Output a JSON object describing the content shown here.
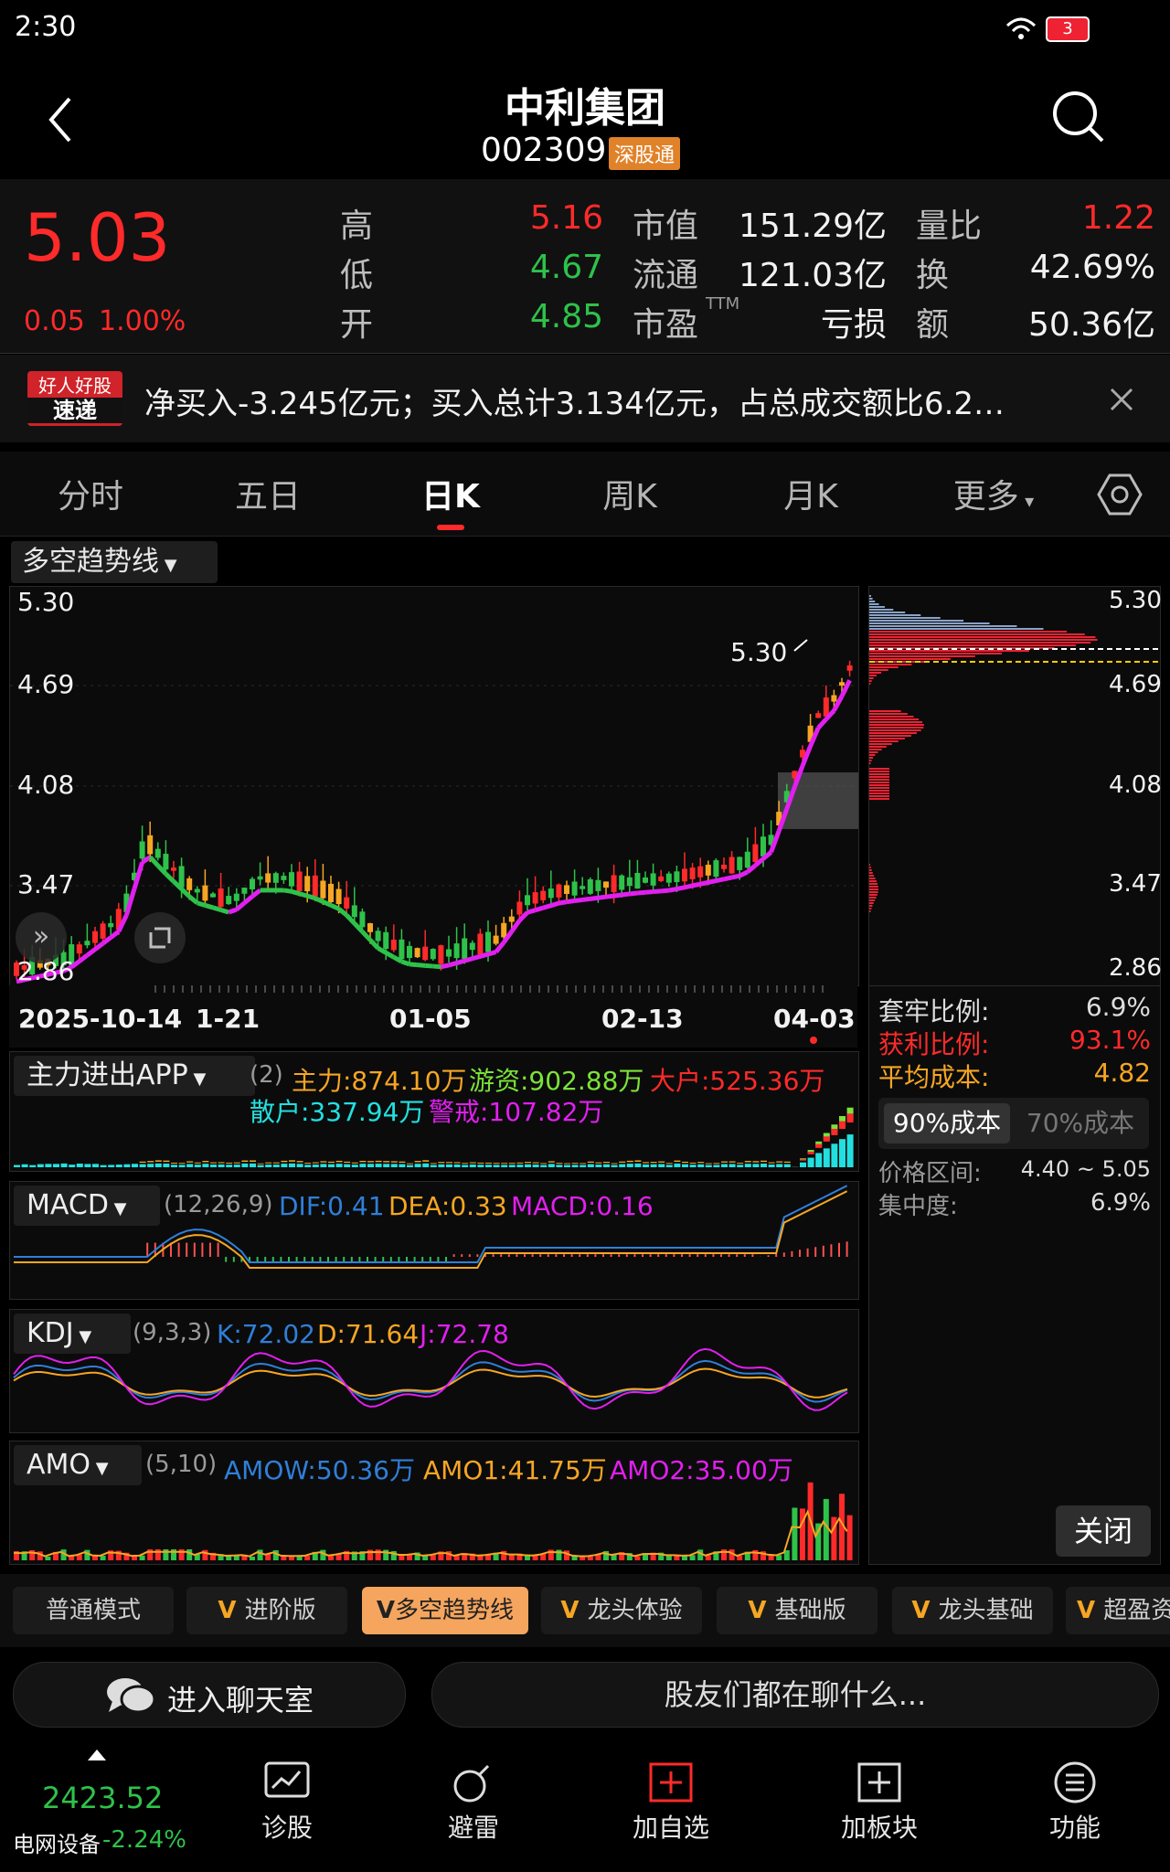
{
  "status": {
    "time": "2:30",
    "battery": "3"
  },
  "header": {
    "title": "中利集团",
    "code": "002309",
    "tag": "深股通"
  },
  "quote": {
    "price": "5.03",
    "change": "0.05",
    "change_pct": "1.00%",
    "high_label": "高",
    "high": "5.16",
    "low_label": "低",
    "low": "4.67",
    "open_label": "开",
    "open": "4.85",
    "mcap_label": "市值",
    "mcap": "151.29亿",
    "float_label": "流通",
    "float": "121.03亿",
    "pe_label": "市盈",
    "pe_sup": "TTM",
    "pe": "亏损",
    "vr_label": "量比",
    "vr": "1.22",
    "turn_label": "换",
    "turn": "42.69%",
    "amt_label": "额",
    "amt": "50.36亿"
  },
  "news": {
    "badge_top": "好人好股",
    "badge_bottom": "速递",
    "text": "净买入-3.245亿元；买入总计3.134亿元，占总成交额比6.2…"
  },
  "tabs": [
    "分时",
    "五日",
    "日K",
    "周K",
    "月K",
    "更多"
  ],
  "active_tab": "日K",
  "indicator_select": "多空趋势线",
  "price_axis": [
    "5.30",
    "4.69",
    "4.08",
    "3.47",
    "2.86"
  ],
  "date_axis": [
    "2025-10-14",
    "1-21",
    "01-05",
    "02-13",
    "04-03"
  ],
  "chart_annotation": "5.30",
  "cost": {
    "trap_label": "套牢比例:",
    "trap": "6.9%",
    "profit_label": "获利比例:",
    "profit": "93.1%",
    "avg_label": "平均成本:",
    "avg": "4.82",
    "btn90": "90%成本",
    "btn70": "70%成本",
    "range_label": "价格区间:",
    "range": "4.40 ~ 5.05",
    "conc_label": "集中度:",
    "conc": "6.9%",
    "close": "关闭"
  },
  "ind1": {
    "name": "主力进出APP",
    "param": "(2)",
    "a": "主力:874.10万",
    "b": "游资:902.88万",
    "c": "大户:525.36万",
    "d": "散户:337.94万",
    "e": "警戒:107.82万"
  },
  "macd": {
    "name": "MACD",
    "param": "(12,26,9)",
    "dif": "DIF:0.41",
    "dea": "DEA:0.33",
    "macd": "MACD:0.16"
  },
  "kdj": {
    "name": "KDJ",
    "param": "(9,3,3)",
    "k": "K:72.02",
    "d": "D:71.64",
    "j": "J:72.78"
  },
  "amo": {
    "name": "AMO",
    "param": "(5,10)",
    "w": "AMOW:50.36万",
    "a1": "AMO1:41.75万",
    "a2": "AMO2:35.00万"
  },
  "modes": [
    "普通模式",
    "进阶版",
    "多空趋势线",
    "龙头体验",
    "基础版",
    "龙头基础",
    "超盈资"
  ],
  "chat": {
    "enter": "进入聊天室",
    "prompt": "股友们都在聊什么..."
  },
  "bottom": {
    "index_value": "2423.52",
    "index_name": "电网设备",
    "index_pct": "-2.24%",
    "items": [
      "诊股",
      "避雷",
      "加自选",
      "加板块",
      "功能"
    ]
  },
  "colors": {
    "up": "#ff2a2a",
    "down": "#2ec24a",
    "accent": "#f6a623",
    "magenta": "#e21ff0",
    "blue": "#2f7fd9"
  }
}
